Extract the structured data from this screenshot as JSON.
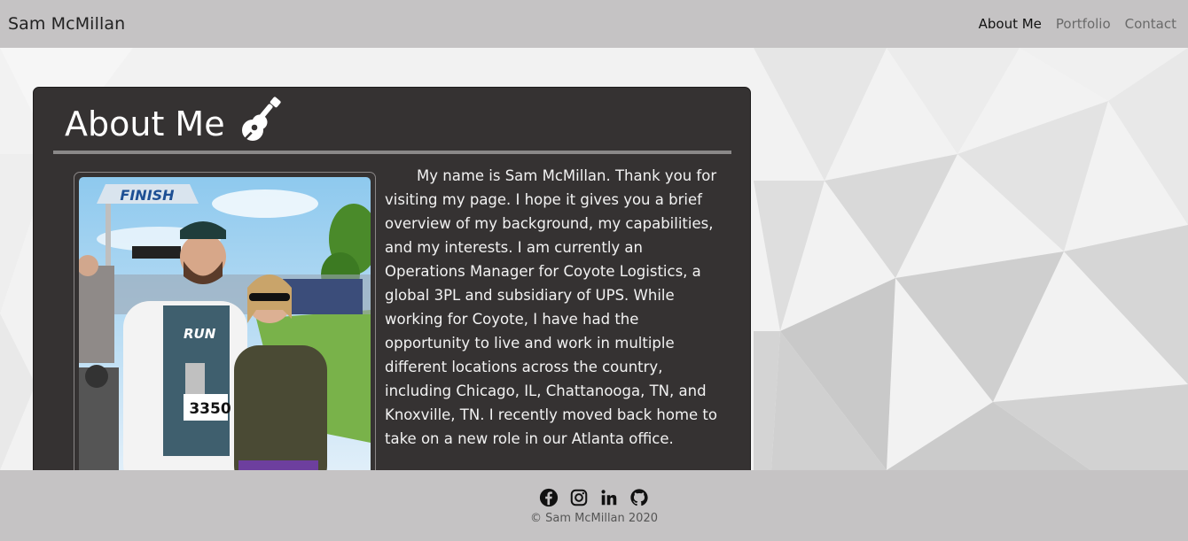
{
  "navbar": {
    "brand": "Sam McMillan",
    "links": [
      {
        "label": "About Me",
        "active": true
      },
      {
        "label": "Portfolio",
        "active": false
      },
      {
        "label": "Contact",
        "active": false
      }
    ]
  },
  "about": {
    "title": "About Me",
    "title_icon": "guitar-icon",
    "bio": "My name is Sam McMillan. Thank you for visiting my page. I hope it gives you a brief overview of my background, my capabilities, and my interests. I am currently an Operations Manager for Coyote Logistics, a global 3PL and subsidiary of UPS. While working for Coyote, I have had the opportunity to live and work in multiple different locations across the country, including Chicago, IL, Chattanooga, TN, and Knoxville, TN. I recently moved back home to take on a new role in our Atlanta office.",
    "photo": {
      "banner_text": "FINISH",
      "bib_number": "3350",
      "shirt_text": "RUN"
    }
  },
  "footer": {
    "social_icons": [
      "facebook-icon",
      "instagram-icon",
      "linkedin-icon",
      "github-icon"
    ],
    "copyright": "© Sam McMillan 2020"
  },
  "colors": {
    "navbar_bg": "#c5c3c4",
    "card_bg": "#353232",
    "divider": "#8a8888"
  }
}
